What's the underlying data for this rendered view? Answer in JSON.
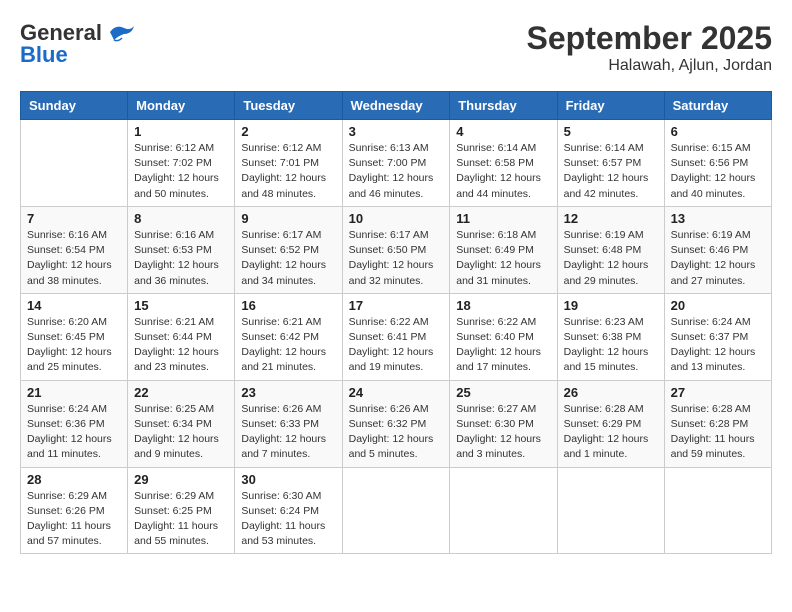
{
  "logo": {
    "text_general": "General",
    "text_blue": "Blue"
  },
  "title": "September 2025",
  "subtitle": "Halawah, Ajlun, Jordan",
  "days_header": [
    "Sunday",
    "Monday",
    "Tuesday",
    "Wednesday",
    "Thursday",
    "Friday",
    "Saturday"
  ],
  "weeks": [
    [
      {
        "day": "",
        "info": ""
      },
      {
        "day": "1",
        "info": "Sunrise: 6:12 AM\nSunset: 7:02 PM\nDaylight: 12 hours\nand 50 minutes."
      },
      {
        "day": "2",
        "info": "Sunrise: 6:12 AM\nSunset: 7:01 PM\nDaylight: 12 hours\nand 48 minutes."
      },
      {
        "day": "3",
        "info": "Sunrise: 6:13 AM\nSunset: 7:00 PM\nDaylight: 12 hours\nand 46 minutes."
      },
      {
        "day": "4",
        "info": "Sunrise: 6:14 AM\nSunset: 6:58 PM\nDaylight: 12 hours\nand 44 minutes."
      },
      {
        "day": "5",
        "info": "Sunrise: 6:14 AM\nSunset: 6:57 PM\nDaylight: 12 hours\nand 42 minutes."
      },
      {
        "day": "6",
        "info": "Sunrise: 6:15 AM\nSunset: 6:56 PM\nDaylight: 12 hours\nand 40 minutes."
      }
    ],
    [
      {
        "day": "7",
        "info": "Sunrise: 6:16 AM\nSunset: 6:54 PM\nDaylight: 12 hours\nand 38 minutes."
      },
      {
        "day": "8",
        "info": "Sunrise: 6:16 AM\nSunset: 6:53 PM\nDaylight: 12 hours\nand 36 minutes."
      },
      {
        "day": "9",
        "info": "Sunrise: 6:17 AM\nSunset: 6:52 PM\nDaylight: 12 hours\nand 34 minutes."
      },
      {
        "day": "10",
        "info": "Sunrise: 6:17 AM\nSunset: 6:50 PM\nDaylight: 12 hours\nand 32 minutes."
      },
      {
        "day": "11",
        "info": "Sunrise: 6:18 AM\nSunset: 6:49 PM\nDaylight: 12 hours\nand 31 minutes."
      },
      {
        "day": "12",
        "info": "Sunrise: 6:19 AM\nSunset: 6:48 PM\nDaylight: 12 hours\nand 29 minutes."
      },
      {
        "day": "13",
        "info": "Sunrise: 6:19 AM\nSunset: 6:46 PM\nDaylight: 12 hours\nand 27 minutes."
      }
    ],
    [
      {
        "day": "14",
        "info": "Sunrise: 6:20 AM\nSunset: 6:45 PM\nDaylight: 12 hours\nand 25 minutes."
      },
      {
        "day": "15",
        "info": "Sunrise: 6:21 AM\nSunset: 6:44 PM\nDaylight: 12 hours\nand 23 minutes."
      },
      {
        "day": "16",
        "info": "Sunrise: 6:21 AM\nSunset: 6:42 PM\nDaylight: 12 hours\nand 21 minutes."
      },
      {
        "day": "17",
        "info": "Sunrise: 6:22 AM\nSunset: 6:41 PM\nDaylight: 12 hours\nand 19 minutes."
      },
      {
        "day": "18",
        "info": "Sunrise: 6:22 AM\nSunset: 6:40 PM\nDaylight: 12 hours\nand 17 minutes."
      },
      {
        "day": "19",
        "info": "Sunrise: 6:23 AM\nSunset: 6:38 PM\nDaylight: 12 hours\nand 15 minutes."
      },
      {
        "day": "20",
        "info": "Sunrise: 6:24 AM\nSunset: 6:37 PM\nDaylight: 12 hours\nand 13 minutes."
      }
    ],
    [
      {
        "day": "21",
        "info": "Sunrise: 6:24 AM\nSunset: 6:36 PM\nDaylight: 12 hours\nand 11 minutes."
      },
      {
        "day": "22",
        "info": "Sunrise: 6:25 AM\nSunset: 6:34 PM\nDaylight: 12 hours\nand 9 minutes."
      },
      {
        "day": "23",
        "info": "Sunrise: 6:26 AM\nSunset: 6:33 PM\nDaylight: 12 hours\nand 7 minutes."
      },
      {
        "day": "24",
        "info": "Sunrise: 6:26 AM\nSunset: 6:32 PM\nDaylight: 12 hours\nand 5 minutes."
      },
      {
        "day": "25",
        "info": "Sunrise: 6:27 AM\nSunset: 6:30 PM\nDaylight: 12 hours\nand 3 minutes."
      },
      {
        "day": "26",
        "info": "Sunrise: 6:28 AM\nSunset: 6:29 PM\nDaylight: 12 hours\nand 1 minute."
      },
      {
        "day": "27",
        "info": "Sunrise: 6:28 AM\nSunset: 6:28 PM\nDaylight: 11 hours\nand 59 minutes."
      }
    ],
    [
      {
        "day": "28",
        "info": "Sunrise: 6:29 AM\nSunset: 6:26 PM\nDaylight: 11 hours\nand 57 minutes."
      },
      {
        "day": "29",
        "info": "Sunrise: 6:29 AM\nSunset: 6:25 PM\nDaylight: 11 hours\nand 55 minutes."
      },
      {
        "day": "30",
        "info": "Sunrise: 6:30 AM\nSunset: 6:24 PM\nDaylight: 11 hours\nand 53 minutes."
      },
      {
        "day": "",
        "info": ""
      },
      {
        "day": "",
        "info": ""
      },
      {
        "day": "",
        "info": ""
      },
      {
        "day": "",
        "info": ""
      }
    ]
  ]
}
